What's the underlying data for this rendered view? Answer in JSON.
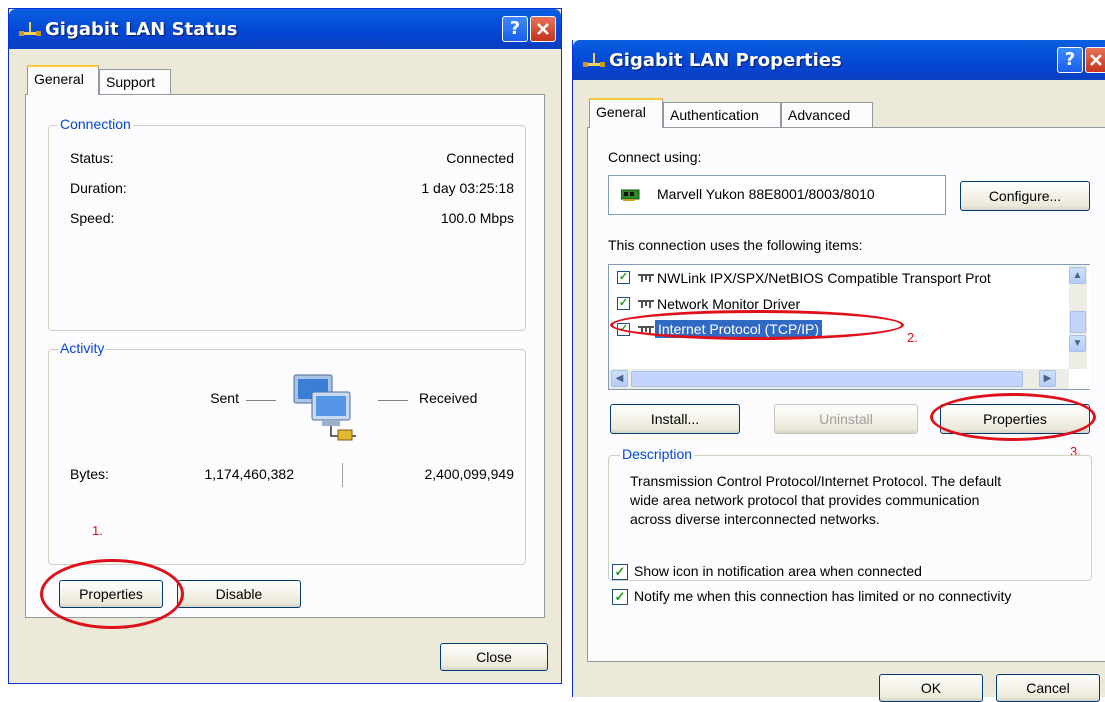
{
  "status_window": {
    "title": "Gigabit LAN Status",
    "help_button": "?",
    "tabs": [
      "General",
      "Support"
    ],
    "connection": {
      "group_label": "Connection",
      "rows": [
        {
          "label": "Status:",
          "value": "Connected"
        },
        {
          "label": "Duration:",
          "value": "1 day 03:25:18"
        },
        {
          "label": "Speed:",
          "value": "100.0 Mbps"
        }
      ]
    },
    "activity": {
      "group_label": "Activity",
      "sent_label": "Sent",
      "received_label": "Received",
      "bytes_label": "Bytes:",
      "bytes_sent": "1,174,460,382",
      "bytes_received": "2,400,099,949"
    },
    "annotation": "1.",
    "buttons": {
      "properties": "Properties",
      "disable": "Disable",
      "close": "Close"
    }
  },
  "properties_window": {
    "title": "Gigabit LAN Properties",
    "help_button": "?",
    "tabs": [
      "General",
      "Authentication",
      "Advanced"
    ],
    "connect_using_label": "Connect using:",
    "adapter_name": "Marvell Yukon 88E8001/8003/8010",
    "configure_button": "Configure...",
    "items_label": "This connection uses the following items:",
    "items": [
      {
        "label": "NWLink IPX/SPX/NetBIOS Compatible Transport Prot",
        "checked": true
      },
      {
        "label": "Network Monitor Driver",
        "checked": true
      },
      {
        "label": "Internet Protocol (TCP/IP)",
        "checked": true,
        "selected": true
      }
    ],
    "annotation_2": "2.",
    "annotation_3": "3.",
    "buttons": {
      "install": "Install...",
      "uninstall": "Uninstall",
      "properties": "Properties",
      "ok": "OK",
      "cancel": "Cancel"
    },
    "description": {
      "group_label": "Description",
      "lines": [
        "Transmission Control Protocol/Internet Protocol. The default",
        "wide area network protocol that provides communication",
        "across diverse interconnected networks."
      ]
    },
    "options": [
      {
        "label": "Show icon in notification area when connected",
        "checked": true
      },
      {
        "label": "Notify me when this connection has limited or no connectivity",
        "checked": true
      }
    ]
  },
  "colors": {
    "titlebar": "#0346d4",
    "annotation_red": "#e0101a",
    "selection": "#316ac5",
    "group_label": "#0046d5"
  }
}
